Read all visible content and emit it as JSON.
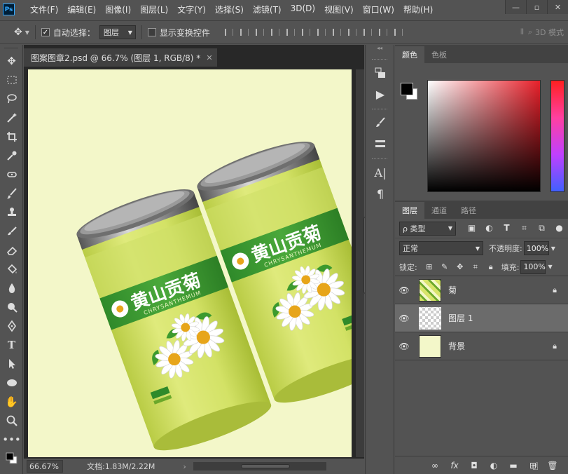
{
  "app": {
    "logo": "Ps"
  },
  "menu": [
    "文件(F)",
    "编辑(E)",
    "图像(I)",
    "图层(L)",
    "文字(Y)",
    "选择(S)",
    "滤镜(T)",
    "3D(D)",
    "视图(V)",
    "窗口(W)",
    "帮助(H)"
  ],
  "window_controls": {
    "minimize": "—",
    "restore": "▫",
    "close": "✕"
  },
  "options": {
    "auto_select_label": "自动选择：",
    "auto_select_value": "图层",
    "show_transform_label": "显示变换控件",
    "mode_3d": "3D 模式"
  },
  "document": {
    "tab_title": "图案图章2.psd @ 66.7% (图层 1, RGB/8) *",
    "tab_close": "✕",
    "zoom": "66.67%",
    "doc_info": "文档:1.83M/2.22M",
    "status_arrow": "›"
  },
  "product": {
    "brand": "黄山贡菊",
    "sub": "CHRYSANTHEMUM"
  },
  "color_panel": {
    "tabs": [
      "颜色",
      "色板"
    ],
    "foreground": "#000000",
    "background": "#ffffff"
  },
  "layers_panel": {
    "tabs": [
      "图层",
      "通道",
      "路径"
    ],
    "kind_label": "ρ 类型",
    "blend_mode": "正常",
    "opacity_label": "不透明度:",
    "opacity_value": "100%",
    "lock_label": "锁定:",
    "fill_label": "填充:",
    "fill_value": "100%",
    "layers": [
      {
        "name": "菊",
        "thumb": "pattern",
        "locked": true,
        "selected": false
      },
      {
        "name": "图层 1",
        "thumb": "transparent",
        "locked": false,
        "selected": true
      },
      {
        "name": "背景",
        "thumb": "fill",
        "locked": true,
        "selected": false
      }
    ],
    "footer_icons": [
      "link-icon",
      "fx-icon",
      "mask-icon",
      "adjustment-icon",
      "folder-icon",
      "new-layer-icon",
      "trash-icon"
    ]
  }
}
